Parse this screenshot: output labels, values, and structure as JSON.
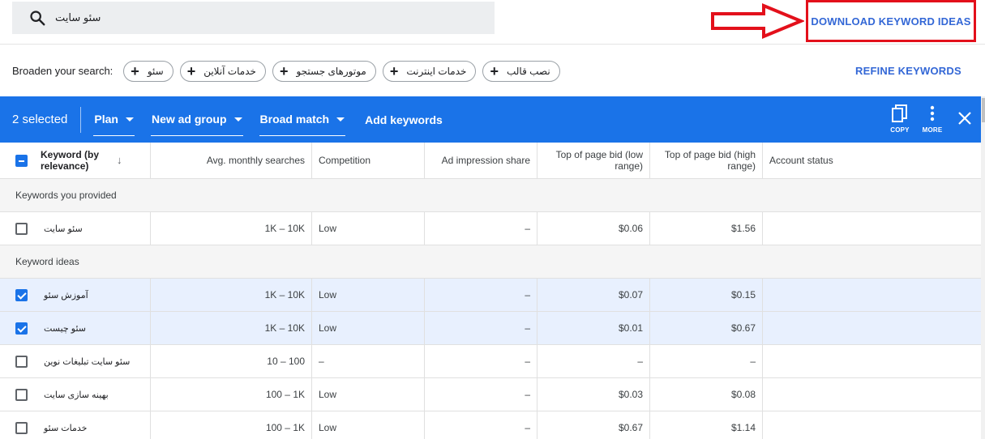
{
  "search": {
    "query": "سئو سایت"
  },
  "download_link": "DOWNLOAD KEYWORD IDEAS",
  "broaden": {
    "label": "Broaden your search:",
    "chips": [
      "سئو",
      "خدمات آنلاین",
      "موتورهای جستجو",
      "خدمات اینترنت",
      "نصب قالب"
    ]
  },
  "refine_link": "REFINE KEYWORDS",
  "toolbar": {
    "selected_count": "2 selected",
    "plan_label": "Plan",
    "ad_group_label": "New ad group",
    "match_label": "Broad match",
    "add_keywords_label": "Add keywords",
    "copy_label": "COPY",
    "more_label": "MORE"
  },
  "columns": {
    "keyword": "Keyword (by relevance)",
    "avg": "Avg. monthly searches",
    "competition": "Competition",
    "impression": "Ad impression share",
    "bid_low": "Top of page bid (low range)",
    "bid_high": "Top of page bid (high range)",
    "account": "Account status"
  },
  "sections": {
    "provided": "Keywords you provided",
    "ideas": "Keyword ideas"
  },
  "provided_rows": [
    {
      "keyword": "سئو سایت",
      "avg": "1K – 10K",
      "competition": "Low",
      "impression": "–",
      "bid_low": "$0.06",
      "bid_high": "$1.56",
      "account": "",
      "checked": false
    }
  ],
  "idea_rows": [
    {
      "keyword": "آموزش سئو",
      "avg": "1K – 10K",
      "competition": "Low",
      "impression": "–",
      "bid_low": "$0.07",
      "bid_high": "$0.15",
      "account": "",
      "checked": true
    },
    {
      "keyword": "سئو چیست",
      "avg": "1K – 10K",
      "competition": "Low",
      "impression": "–",
      "bid_low": "$0.01",
      "bid_high": "$0.67",
      "account": "",
      "checked": true
    },
    {
      "keyword": "سئو سایت تبلیغات نوین",
      "avg": "10 – 100",
      "competition": "–",
      "impression": "–",
      "bid_low": "–",
      "bid_high": "–",
      "account": "",
      "checked": false
    },
    {
      "keyword": "بهینه سازی سایت",
      "avg": "100 – 1K",
      "competition": "Low",
      "impression": "–",
      "bid_low": "$0.03",
      "bid_high": "$0.08",
      "account": "",
      "checked": false
    },
    {
      "keyword": "خدمات سئو",
      "avg": "100 – 1K",
      "competition": "Low",
      "impression": "–",
      "bid_low": "$0.67",
      "bid_high": "$1.14",
      "account": "",
      "checked": false
    }
  ],
  "colors": {
    "toolbar_blue": "#1a73e8",
    "link_blue": "#3367d6",
    "annotation_red": "#e3101b",
    "selected_row": "#e8f0fe",
    "section_bg": "#f5f5f5"
  }
}
